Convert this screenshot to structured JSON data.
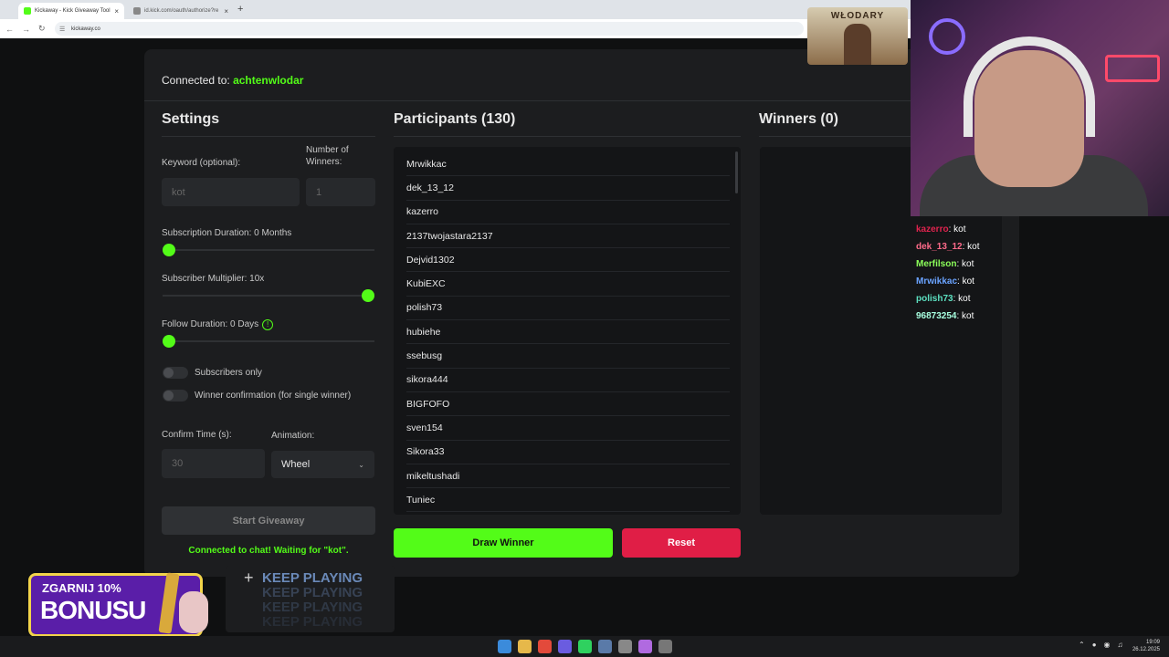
{
  "browser": {
    "active_tab": "Kickaway - Kick Giveaway Tool",
    "inactive_tab": "id.kick.com/oauth/authorize?re",
    "url": "kickaway.co",
    "new_tab_symbol": "+",
    "tab_close_symbol": "×"
  },
  "app": {
    "connected_label": "Connected to:",
    "connected_user": "achtenwlodar",
    "settings": {
      "title": "Settings",
      "keyword_label": "Keyword (optional):",
      "keyword_value": "kot",
      "winners_label": "Number of Winners:",
      "winners_value": "1",
      "sub_duration_label": "Subscription Duration: 0 Months",
      "sub_duration_value": 0,
      "sub_multiplier_label": "Subscriber Multiplier: 10x",
      "sub_multiplier_value": 1.0,
      "follow_duration_label": "Follow Duration: 0 Days",
      "follow_duration_value": 0,
      "info_symbol": "!",
      "subscribers_only_label": "Subscribers only",
      "winner_confirmation_label": "Winner confirmation (for single winner)",
      "confirm_time_label": "Confirm Time (s):",
      "confirm_time_value": "30",
      "animation_label": "Animation:",
      "animation_value": "Wheel",
      "start_button": "Start Giveaway",
      "chat_status": "Connected to chat! Waiting for \"kot\"."
    },
    "participants": {
      "title": "Participants (130)",
      "names": [
        "Mrwikkac",
        "dek_13_12",
        "kazerro",
        "2137twojastara2137",
        "Dejvid1302",
        "KubiEXC",
        "polish73",
        "hubiehe",
        "ssebusg",
        "sikora444",
        "BIGFOFO",
        "sven154",
        "Sikora33",
        "mikeltushadi",
        "Tuniec"
      ]
    },
    "winners": {
      "title": "Winners (0)"
    },
    "draw_button": "Draw Winner",
    "reset_button": "Reset"
  },
  "stream": {
    "logo_text": "WŁODARY",
    "chat": [
      {
        "user": "kazerro",
        "msg": ": kot",
        "color": "#e0234e"
      },
      {
        "user": "dek_13_12",
        "msg": ": kot",
        "color": "#ff6b8a"
      },
      {
        "user": "Merfilson",
        "msg": ": kot",
        "color": "#8cff5a"
      },
      {
        "user": "Mrwikkac",
        "msg": ": kot",
        "color": "#6aa3ff"
      },
      {
        "user": "polish73",
        "msg": ": kot",
        "color": "#5ce0c0"
      },
      {
        "user": "96873254",
        "msg": ": kot",
        "color": "#a8ffe0"
      }
    ],
    "promo_line1": "ZGARNIJ 10%",
    "promo_line2": "BONUSU",
    "keep_playing": "KEEP PLAYING"
  },
  "taskbar": {
    "time": "19:09",
    "date": "26.12.2025"
  },
  "colors": {
    "accent": "#53fc18",
    "danger": "#e01e46",
    "card": "#1c1d1f"
  }
}
